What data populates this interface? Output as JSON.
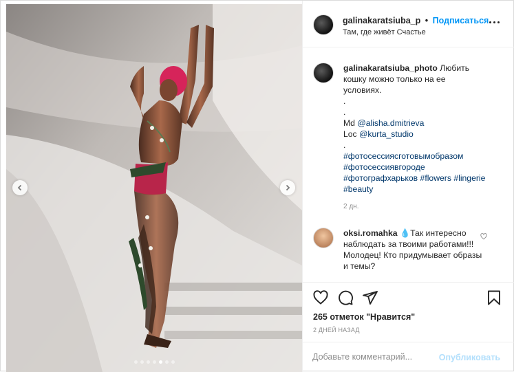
{
  "post": {
    "photo_alt": "",
    "carousel": {
      "total": 7,
      "active": 5
    }
  },
  "header": {
    "username": "galinakaratsiuba_p",
    "separator": "•",
    "follow_label": "Подписаться",
    "location": "Там, где живёт Счастье"
  },
  "caption": {
    "username": "galinakaratsiuba_photo",
    "text_line1": "Любить",
    "text_line2": "кошку можно только на ее",
    "text_line3": "условиях.",
    "dot1": ".",
    "dot2": ".",
    "md_label": "Md",
    "md_link": "@alisha.dmitrieva",
    "loc_label": "Loc",
    "loc_link": "@kurta_studio",
    "dot3": ".",
    "tag1": "#фотосессиясготовымобразом",
    "tag2": "#фотосессиявгороде",
    "tag3": "#фотографхарьков",
    "tag4": "#flowers",
    "tag5": "#lingerie",
    "tag6": "#beauty",
    "time": "2 дн."
  },
  "comment": {
    "username": "oksi.romahka",
    "emoji": "💧",
    "text": "Так интересно наблюдать за твоими работами!!! Молодец! Кто придумывает образы и темы?"
  },
  "actions": {
    "likes_text": "265 отметок \"Нравится\"",
    "time_text": "2 ДНЕЙ НАЗАД"
  },
  "add_comment": {
    "placeholder": "Добавьте комментарий...",
    "publish_label": "Опубликовать"
  },
  "icons": {
    "like": "heart-icon",
    "comment": "comment-icon",
    "share": "paper-plane-icon",
    "save": "bookmark-icon",
    "more": "more-options-icon",
    "prev": "chevron-left-icon",
    "next": "chevron-right-icon"
  },
  "colors": {
    "accent": "#0095f6",
    "link": "#00376b",
    "hair": "#d6245a",
    "publish_disabled": "#b2dffc"
  }
}
